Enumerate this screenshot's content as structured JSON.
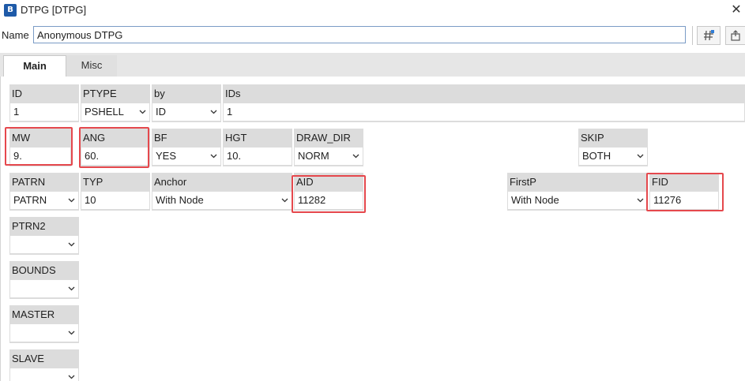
{
  "window": {
    "title": "DTPG [DTPG]",
    "close_glyph": "✕"
  },
  "name_row": {
    "label": "Name",
    "value": "Anonymous DTPG"
  },
  "tabs": [
    {
      "label": "Main",
      "active": true
    },
    {
      "label": "Misc",
      "active": false
    }
  ],
  "fields": {
    "id": {
      "label": "ID",
      "value": "1"
    },
    "ptype": {
      "label": "PTYPE",
      "value": "PSHELL"
    },
    "by": {
      "label": "by",
      "value": "ID"
    },
    "ids": {
      "label": "IDs",
      "value": "1"
    },
    "mw": {
      "label": "MW",
      "value": "9."
    },
    "ang": {
      "label": "ANG",
      "value": "60."
    },
    "bf": {
      "label": "BF",
      "value": "YES"
    },
    "hgt": {
      "label": "HGT",
      "value": "10."
    },
    "draw_dir": {
      "label": "DRAW_DIR",
      "value": "NORM"
    },
    "skip": {
      "label": "SKIP",
      "value": "BOTH"
    },
    "patrn": {
      "label": "PATRN",
      "value": "PATRN"
    },
    "typ": {
      "label": "TYP",
      "value": "10"
    },
    "anchor": {
      "label": "Anchor",
      "value": "With Node"
    },
    "aid": {
      "label": "AID",
      "value": "11282"
    },
    "firstp": {
      "label": "FirstP",
      "value": "With Node"
    },
    "fid": {
      "label": "FID",
      "value": "11276"
    },
    "ptrn2": {
      "label": "PTRN2",
      "value": ""
    },
    "bounds": {
      "label": "BOUNDS",
      "value": ""
    },
    "master": {
      "label": "MASTER",
      "value": ""
    },
    "slave": {
      "label": "SLAVE",
      "value": ""
    }
  },
  "colors": {
    "highlight": "#e5484d",
    "field_header": "#dcdcdc",
    "input_border": "#7a9cc6"
  }
}
